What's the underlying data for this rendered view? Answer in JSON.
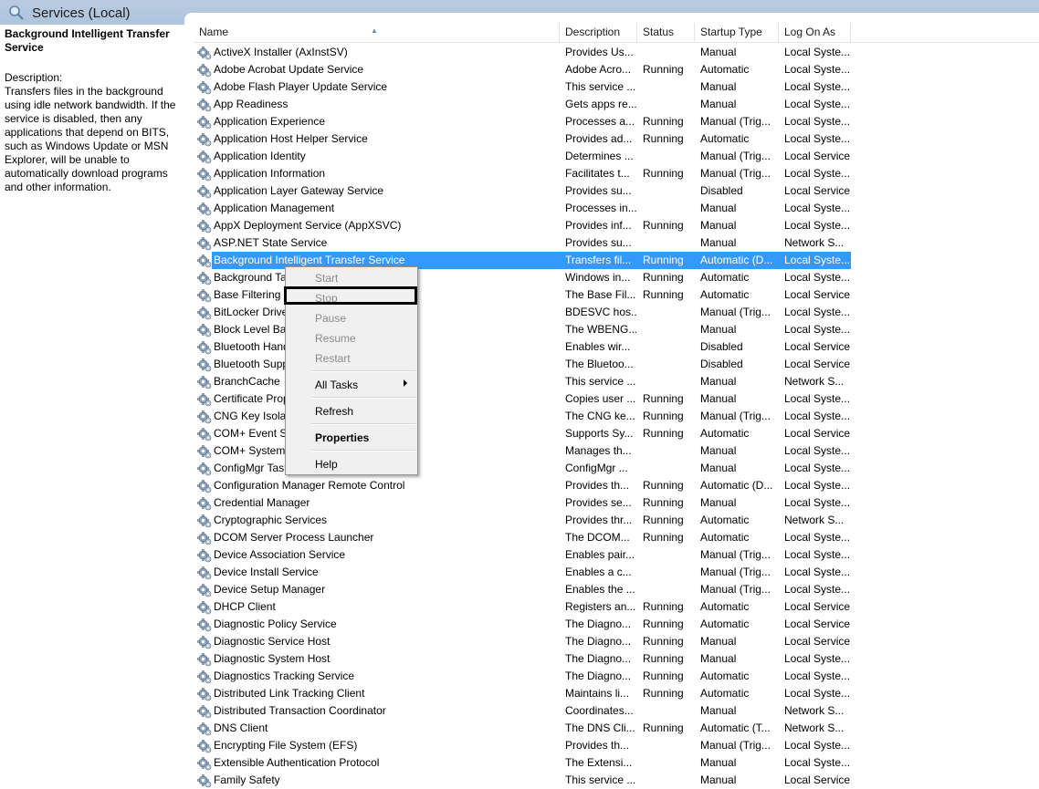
{
  "window": {
    "title": "Services (Local)"
  },
  "left_pane": {
    "service_title": "Background Intelligent Transfer Service",
    "description_label": "Description:",
    "description_text": "Transfers files in the background using idle network bandwidth. If the service is disabled, then any applications that depend on BITS, such as Windows Update or MSN Explorer, will be unable to automatically download programs and other information."
  },
  "columns": {
    "name": "Name",
    "description": "Description",
    "status": "Status",
    "startup_type": "Startup Type",
    "log_on_as": "Log On As"
  },
  "services": [
    {
      "name": "ActiveX Installer (AxInstSV)",
      "description": "Provides Us...",
      "status": "",
      "startup": "Manual",
      "logon": "Local Syste..."
    },
    {
      "name": "Adobe Acrobat Update Service",
      "description": "Adobe Acro...",
      "status": "Running",
      "startup": "Automatic",
      "logon": "Local Syste..."
    },
    {
      "name": "Adobe Flash Player Update Service",
      "description": "This service ...",
      "status": "",
      "startup": "Manual",
      "logon": "Local Syste..."
    },
    {
      "name": "App Readiness",
      "description": "Gets apps re...",
      "status": "",
      "startup": "Manual",
      "logon": "Local Syste..."
    },
    {
      "name": "Application Experience",
      "description": "Processes a...",
      "status": "Running",
      "startup": "Manual (Trig...",
      "logon": "Local Syste..."
    },
    {
      "name": "Application Host Helper Service",
      "description": "Provides ad...",
      "status": "Running",
      "startup": "Automatic",
      "logon": "Local Syste..."
    },
    {
      "name": "Application Identity",
      "description": "Determines ...",
      "status": "",
      "startup": "Manual (Trig...",
      "logon": "Local Service"
    },
    {
      "name": "Application Information",
      "description": "Facilitates t...",
      "status": "Running",
      "startup": "Manual (Trig...",
      "logon": "Local Syste..."
    },
    {
      "name": "Application Layer Gateway Service",
      "description": "Provides su...",
      "status": "",
      "startup": "Disabled",
      "logon": "Local Service"
    },
    {
      "name": "Application Management",
      "description": "Processes in...",
      "status": "",
      "startup": "Manual",
      "logon": "Local Syste..."
    },
    {
      "name": "AppX Deployment Service (AppXSVC)",
      "description": "Provides inf...",
      "status": "Running",
      "startup": "Manual",
      "logon": "Local Syste..."
    },
    {
      "name": "ASP.NET State Service",
      "description": "Provides su...",
      "status": "",
      "startup": "Manual",
      "logon": "Network S..."
    },
    {
      "name": "Background Intelligent Transfer Service",
      "description": "Transfers fil...",
      "status": "Running",
      "startup": "Automatic (D...",
      "logon": "Local Syste...",
      "selected": true
    },
    {
      "name": "Background Tasks Infrastructure Service",
      "description": "Windows in...",
      "status": "Running",
      "startup": "Automatic",
      "logon": "Local Syste..."
    },
    {
      "name": "Base Filtering Engine",
      "description": "The Base Fil...",
      "status": "Running",
      "startup": "Automatic",
      "logon": "Local Service"
    },
    {
      "name": "BitLocker Drive Encryption Service",
      "description": "BDESVC hos...",
      "status": "",
      "startup": "Manual (Trig...",
      "logon": "Local Syste..."
    },
    {
      "name": "Block Level Backup Engine Service",
      "description": "The WBENG...",
      "status": "",
      "startup": "Manual",
      "logon": "Local Syste..."
    },
    {
      "name": "Bluetooth Handsfree Service",
      "description": "Enables wir...",
      "status": "",
      "startup": "Disabled",
      "logon": "Local Service"
    },
    {
      "name": "Bluetooth Support Service",
      "description": "The Bluetoo...",
      "status": "",
      "startup": "Disabled",
      "logon": "Local Service"
    },
    {
      "name": "BranchCache",
      "description": "This service ...",
      "status": "",
      "startup": "Manual",
      "logon": "Network S..."
    },
    {
      "name": "Certificate Propagation",
      "description": "Copies user ...",
      "status": "Running",
      "startup": "Manual",
      "logon": "Local Syste..."
    },
    {
      "name": "CNG Key Isolation",
      "description": "The CNG ke...",
      "status": "Running",
      "startup": "Manual (Trig...",
      "logon": "Local Syste..."
    },
    {
      "name": "COM+ Event System",
      "description": "Supports Sy...",
      "status": "Running",
      "startup": "Automatic",
      "logon": "Local Service"
    },
    {
      "name": "COM+ System Application",
      "description": "Manages th...",
      "status": "",
      "startup": "Manual",
      "logon": "Local Syste..."
    },
    {
      "name": "ConfigMgr Task Sequence Agent",
      "description": "ConfigMgr ...",
      "status": "",
      "startup": "Manual",
      "logon": "Local Syste..."
    },
    {
      "name": "Configuration Manager Remote Control",
      "description": "Provides th...",
      "status": "Running",
      "startup": "Automatic (D...",
      "logon": "Local Syste..."
    },
    {
      "name": "Credential Manager",
      "description": "Provides se...",
      "status": "Running",
      "startup": "Manual",
      "logon": "Local Syste..."
    },
    {
      "name": "Cryptographic Services",
      "description": "Provides thr...",
      "status": "Running",
      "startup": "Automatic",
      "logon": "Network S..."
    },
    {
      "name": "DCOM Server Process Launcher",
      "description": "The DCOM...",
      "status": "Running",
      "startup": "Automatic",
      "logon": "Local Syste..."
    },
    {
      "name": "Device Association Service",
      "description": "Enables pair...",
      "status": "",
      "startup": "Manual (Trig...",
      "logon": "Local Syste..."
    },
    {
      "name": "Device Install Service",
      "description": "Enables a c...",
      "status": "",
      "startup": "Manual (Trig...",
      "logon": "Local Syste..."
    },
    {
      "name": "Device Setup Manager",
      "description": "Enables the ...",
      "status": "",
      "startup": "Manual (Trig...",
      "logon": "Local Syste..."
    },
    {
      "name": "DHCP Client",
      "description": "Registers an...",
      "status": "Running",
      "startup": "Automatic",
      "logon": "Local Service"
    },
    {
      "name": "Diagnostic Policy Service",
      "description": "The Diagno...",
      "status": "Running",
      "startup": "Automatic",
      "logon": "Local Service"
    },
    {
      "name": "Diagnostic Service Host",
      "description": "The Diagno...",
      "status": "Running",
      "startup": "Manual",
      "logon": "Local Service"
    },
    {
      "name": "Diagnostic System Host",
      "description": "The Diagno...",
      "status": "Running",
      "startup": "Manual",
      "logon": "Local Syste..."
    },
    {
      "name": "Diagnostics Tracking Service",
      "description": "The Diagno...",
      "status": "Running",
      "startup": "Automatic",
      "logon": "Local Syste..."
    },
    {
      "name": "Distributed Link Tracking Client",
      "description": "Maintains li...",
      "status": "Running",
      "startup": "Automatic",
      "logon": "Local Syste..."
    },
    {
      "name": "Distributed Transaction Coordinator",
      "description": "Coordinates...",
      "status": "",
      "startup": "Manual",
      "logon": "Network S..."
    },
    {
      "name": "DNS Client",
      "description": "The DNS Cli...",
      "status": "Running",
      "startup": "Automatic (T...",
      "logon": "Network S..."
    },
    {
      "name": "Encrypting File System (EFS)",
      "description": "Provides th...",
      "status": "",
      "startup": "Manual (Trig...",
      "logon": "Local Syste..."
    },
    {
      "name": "Extensible Authentication Protocol",
      "description": "The Extensi...",
      "status": "",
      "startup": "Manual",
      "logon": "Local Syste..."
    },
    {
      "name": "Family Safety",
      "description": "This service ...",
      "status": "",
      "startup": "Manual",
      "logon": "Local Service"
    }
  ],
  "context_menu": {
    "start": "Start",
    "stop": "Stop",
    "pause": "Pause",
    "resume": "Resume",
    "restart": "Restart",
    "all_tasks": "All Tasks",
    "refresh": "Refresh",
    "properties": "Properties",
    "help": "Help"
  }
}
